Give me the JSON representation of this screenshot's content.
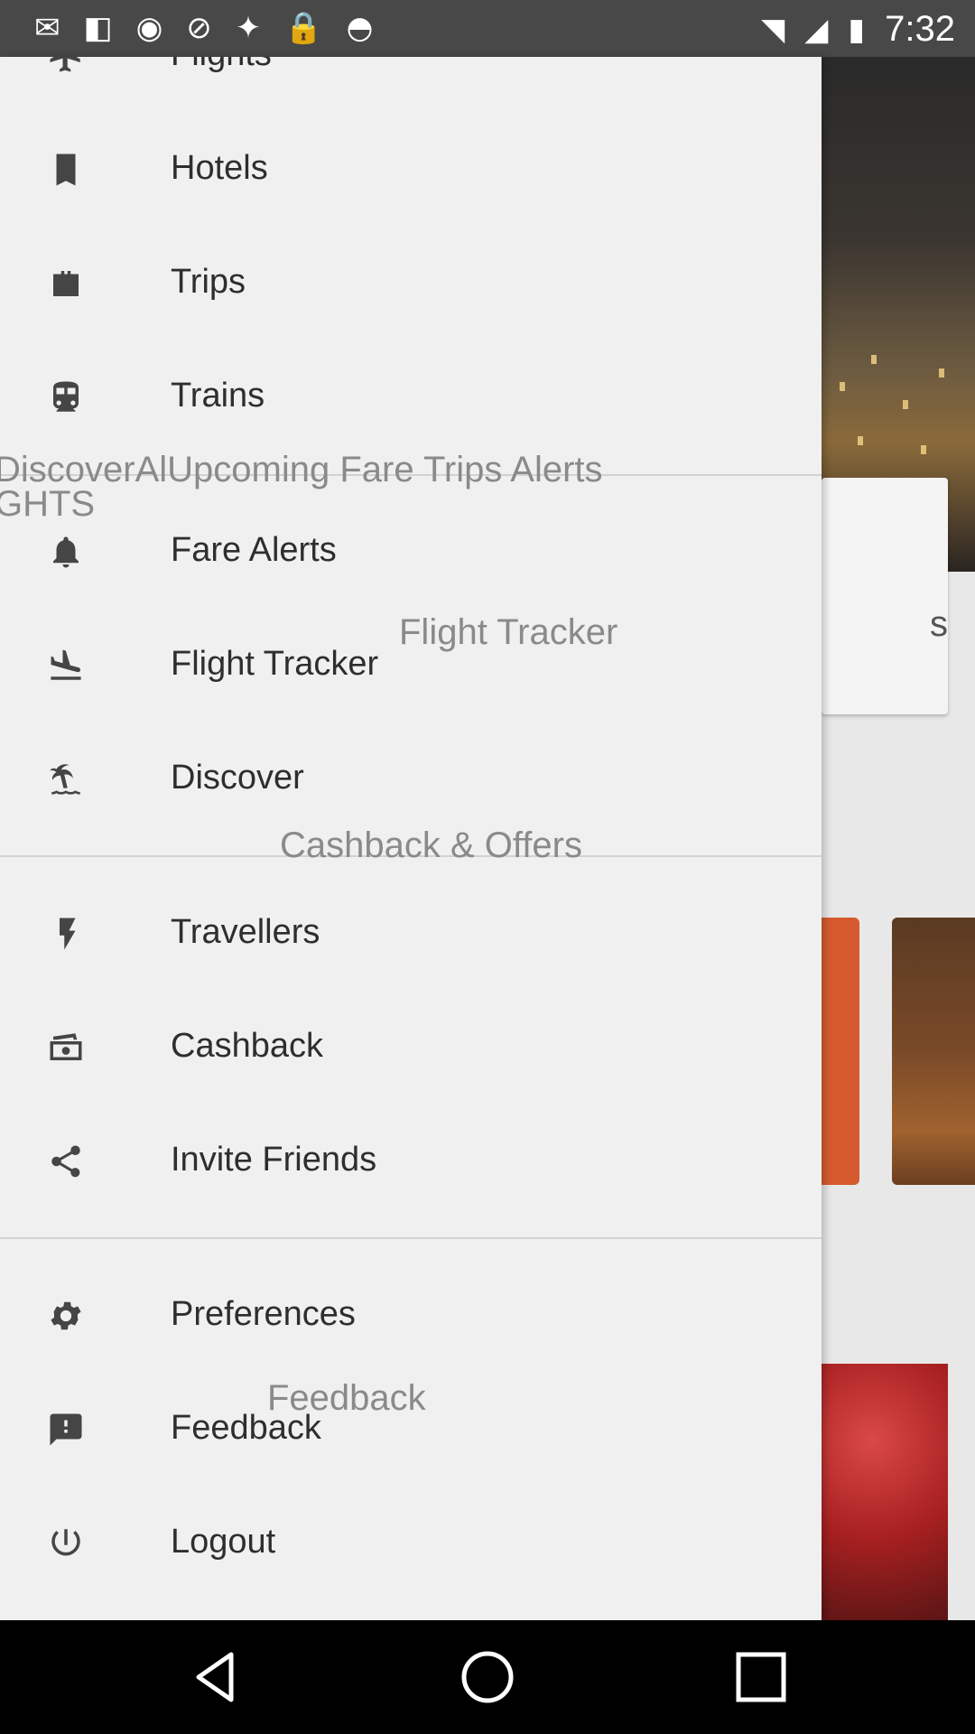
{
  "status_bar": {
    "time": "7:32",
    "left_icons": [
      "mail-icon",
      "flipboard-icon",
      "eye-icon",
      "alarm-icon",
      "fake-gps-icon",
      "lock-icon",
      "android-icon"
    ],
    "right_icons": [
      "wifi-icon",
      "signal-icon",
      "battery-icon"
    ]
  },
  "background": {
    "card_text": "s",
    "ghost_header_1": "DiscoverAlUpcoming Fare Trips Alerts",
    "ghost_header_2": "GHTS",
    "ghost_flight_tracker": "Flight Tracker",
    "ghost_cashback": "Cashback & Offers",
    "ghost_feedback": "Feedback"
  },
  "drawer": {
    "items": [
      {
        "label": "Flights",
        "icon": "plane-icon"
      },
      {
        "label": "Hotels",
        "icon": "hotel-icon"
      },
      {
        "label": "Trips",
        "icon": "briefcase-icon"
      },
      {
        "label": "Trains",
        "icon": "train-icon"
      },
      {
        "label": "Fare Alerts",
        "icon": "bell-icon"
      },
      {
        "label": "Flight Tracker",
        "icon": "flight-land-icon"
      },
      {
        "label": "Discover",
        "icon": "island-icon"
      },
      {
        "label": "Travellers",
        "icon": "flash-icon"
      },
      {
        "label": "Cashback",
        "icon": "money-icon"
      },
      {
        "label": "Invite Friends",
        "icon": "share-icon"
      },
      {
        "label": "Preferences",
        "icon": "gear-icon"
      },
      {
        "label": "Feedback",
        "icon": "feedback-icon"
      },
      {
        "label": "Logout",
        "icon": "power-icon"
      }
    ]
  },
  "nav_bar": {
    "buttons": [
      "back-icon",
      "home-icon",
      "recents-icon"
    ]
  }
}
